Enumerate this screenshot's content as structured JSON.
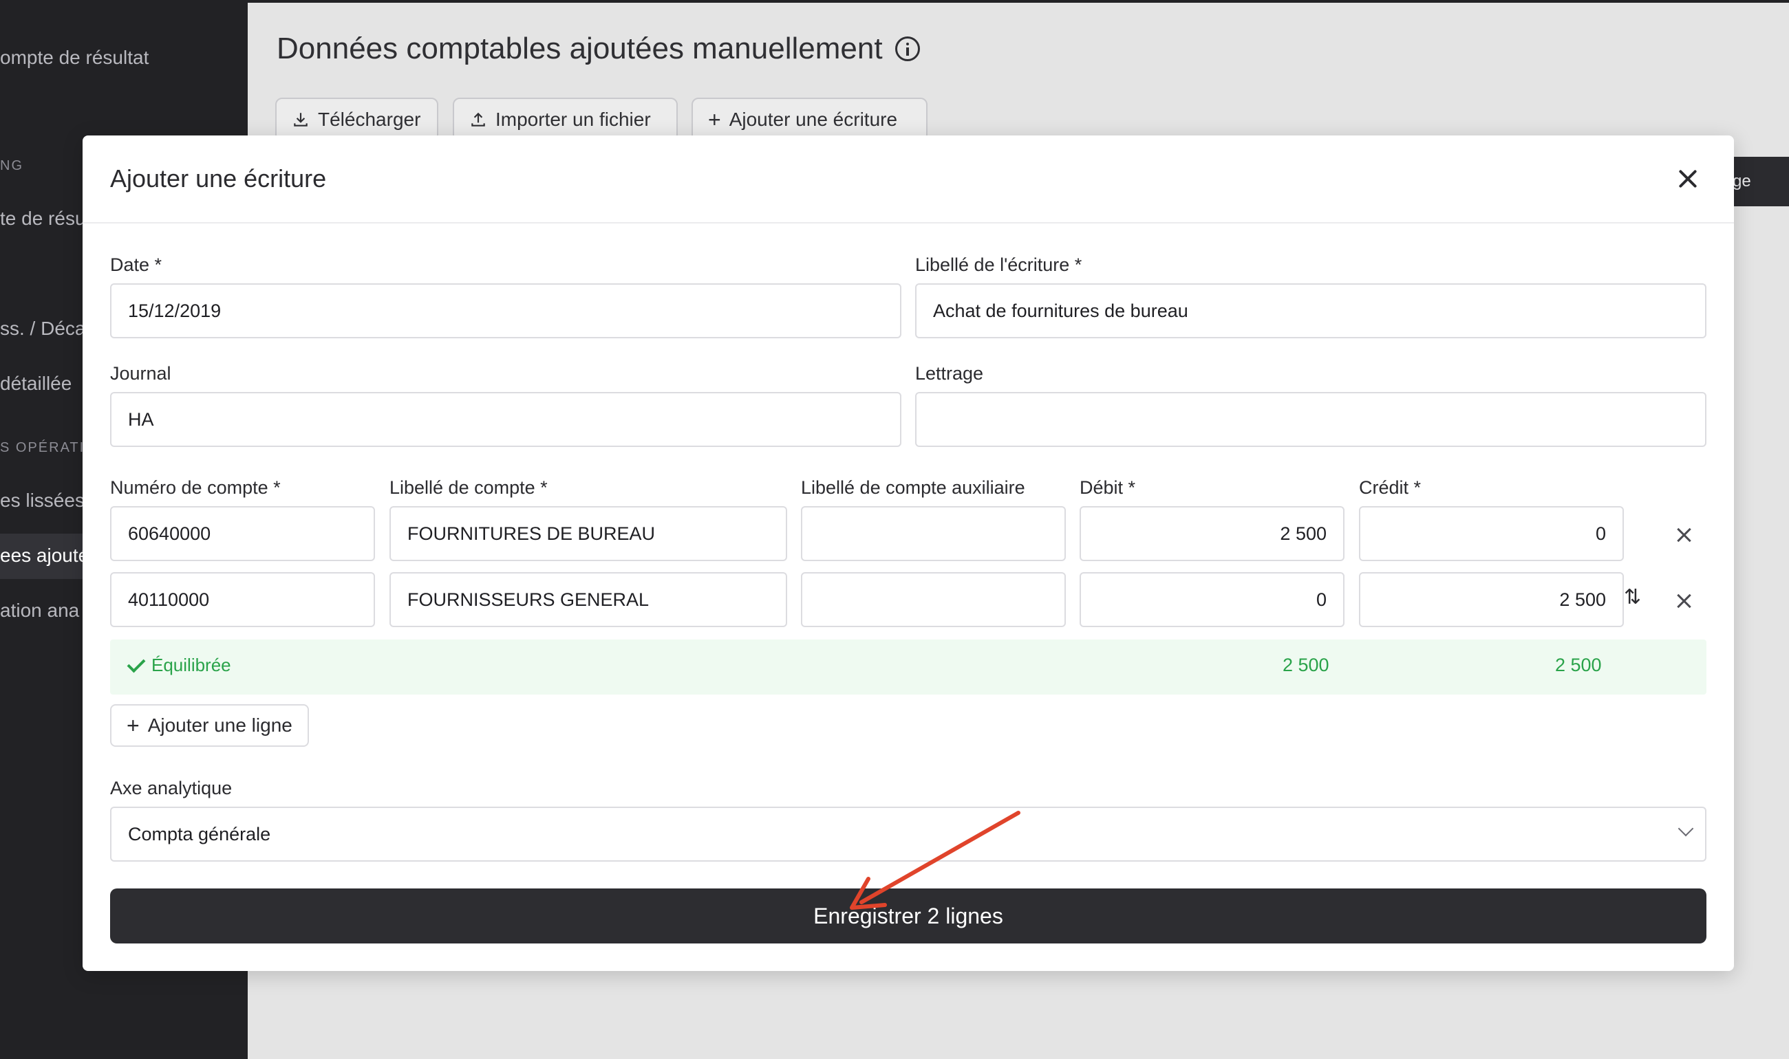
{
  "sidebar": {
    "items": [
      {
        "label": "ompte de résultat"
      },
      {
        "label": "NG"
      },
      {
        "label": "te de résu"
      },
      {
        "label": "ss. / Déca"
      },
      {
        "label": "détaillée"
      },
      {
        "label": "S OPÉRATI"
      },
      {
        "label": "es lissées"
      },
      {
        "label": "ees ajouté"
      },
      {
        "label": "ation ana"
      }
    ]
  },
  "page": {
    "title": "Données comptables ajoutées manuellement",
    "buttons": {
      "download": "Télécharger",
      "import": "Importer un fichier",
      "add_entry": "Ajouter une écriture"
    },
    "partial_tab": "ge"
  },
  "modal": {
    "title": "Ajouter une écriture",
    "date": {
      "label": "Date *",
      "value": "15/12/2019"
    },
    "entry_label": {
      "label": "Libellé de l'écriture *",
      "value": "Achat de fournitures de bureau"
    },
    "journal": {
      "label": "Journal",
      "value": "HA"
    },
    "lettrage": {
      "label": "Lettrage",
      "value": ""
    },
    "columns": {
      "account_number": "Numéro de compte *",
      "account_label": "Libellé de compte *",
      "aux_label": "Libellé de compte auxiliaire",
      "debit": "Débit *",
      "credit": "Crédit *"
    },
    "lines": [
      {
        "account_number": "60640000",
        "account_label": "FOURNITURES DE BUREAU",
        "aux_label": "",
        "debit": "2 500",
        "credit": "0"
      },
      {
        "account_number": "40110000",
        "account_label": "FOURNISSEURS GENERAL",
        "aux_label": "",
        "debit": "0",
        "credit": "2 500"
      }
    ],
    "balance": {
      "status": "Équilibrée",
      "debit_total": "2 500",
      "credit_total": "2 500"
    },
    "add_line": "Ajouter une ligne",
    "analytic_axis": {
      "label": "Axe analytique",
      "value": "Compta générale"
    },
    "save_button": "Enregistrer 2 lignes"
  },
  "colors": {
    "sidebar_bg": "#222225",
    "success": "#2aa34a",
    "primary_button": "#2d2d31",
    "annotation_arrow": "#e0442b"
  },
  "icons": [
    "info-icon",
    "download-icon",
    "upload-icon",
    "plus-icon",
    "close-icon",
    "swap-icon",
    "check-icon",
    "chevron-down-icon"
  ]
}
